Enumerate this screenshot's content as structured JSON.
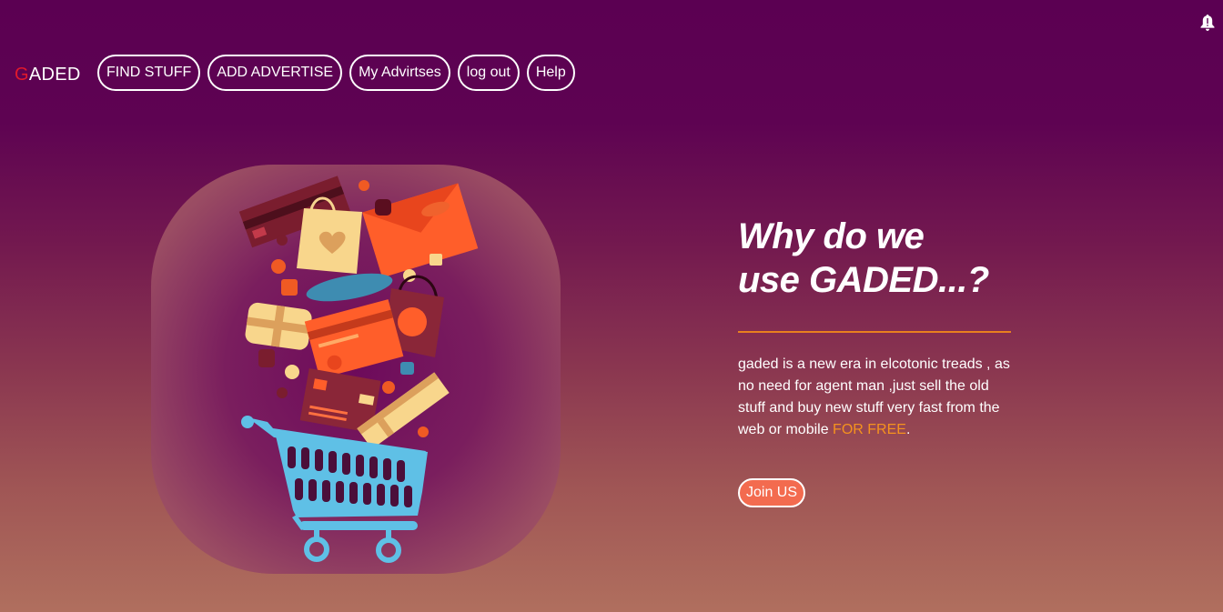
{
  "brand": {
    "first_letter": "G",
    "rest": "ADED"
  },
  "nav": {
    "items": [
      {
        "label": "FIND STUFF"
      },
      {
        "label": "ADD ADVERTISE"
      },
      {
        "label": "My Advirtses"
      },
      {
        "label": "log out"
      },
      {
        "label": "Help"
      }
    ]
  },
  "hero": {
    "heading_line1": "Why do we",
    "heading_line2": "use GADED...?",
    "description": "gaded is a new era in elcotonic treads , as no need for agent man ,just sell the old stuff and buy new stuff very fast from the web or mobile ",
    "highlight": "FOR FREE",
    "description_end": ".",
    "cta_label": "Join US"
  },
  "icons": {
    "notification": "bell-icon",
    "illustration": "shopping-cart-icon"
  },
  "colors": {
    "background_top": "#5b0052",
    "background_bottom": "#b06f5e",
    "accent": "#e8801f",
    "cta": "#f36b4f",
    "logo_letter": "#e0192c"
  }
}
